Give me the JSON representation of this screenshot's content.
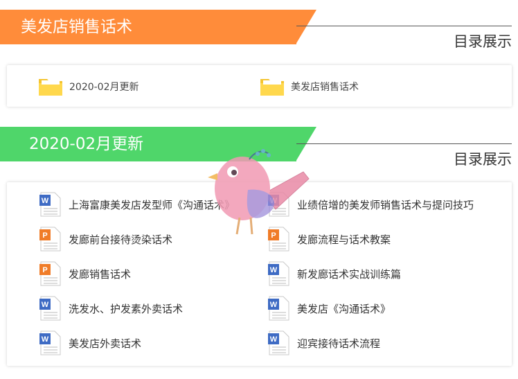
{
  "section1": {
    "title": "美发店销售话术",
    "label": "目录展示",
    "color": "#ff8c3a",
    "folders": [
      {
        "label": "2020-02月更新",
        "icon": "folder-icon"
      },
      {
        "label": "美发店销售话术",
        "icon": "folder-icon"
      }
    ]
  },
  "section2": {
    "title": "2020-02月更新",
    "label": "目录展示",
    "color": "#4fd66a",
    "files_left": [
      {
        "label": "上海富康美发店发型师《沟通话术》",
        "icon": "word-doc-icon"
      },
      {
        "label": "发廊前台接待烫染话术",
        "icon": "ppt-doc-icon"
      },
      {
        "label": "发廊销售话术",
        "icon": "ppt-doc-icon"
      },
      {
        "label": "洗发水、护发素外卖话术",
        "icon": "word-doc-icon"
      },
      {
        "label": "美发店外卖话术",
        "icon": "word-doc-icon"
      }
    ],
    "files_right": [
      {
        "label": "业绩倍增的美发师销售话术与提问技巧",
        "icon": "word-doc-icon"
      },
      {
        "label": "发廊流程与话术教案",
        "icon": "ppt-doc-icon"
      },
      {
        "label": "新发廊话术实战训练篇",
        "icon": "word-doc-icon"
      },
      {
        "label": "美发店《沟通话术》",
        "icon": "word-doc-icon"
      },
      {
        "label": "迎宾接待话术流程",
        "icon": "word-doc-icon"
      }
    ]
  },
  "mascot": {
    "icon": "pink-bird-icon"
  }
}
